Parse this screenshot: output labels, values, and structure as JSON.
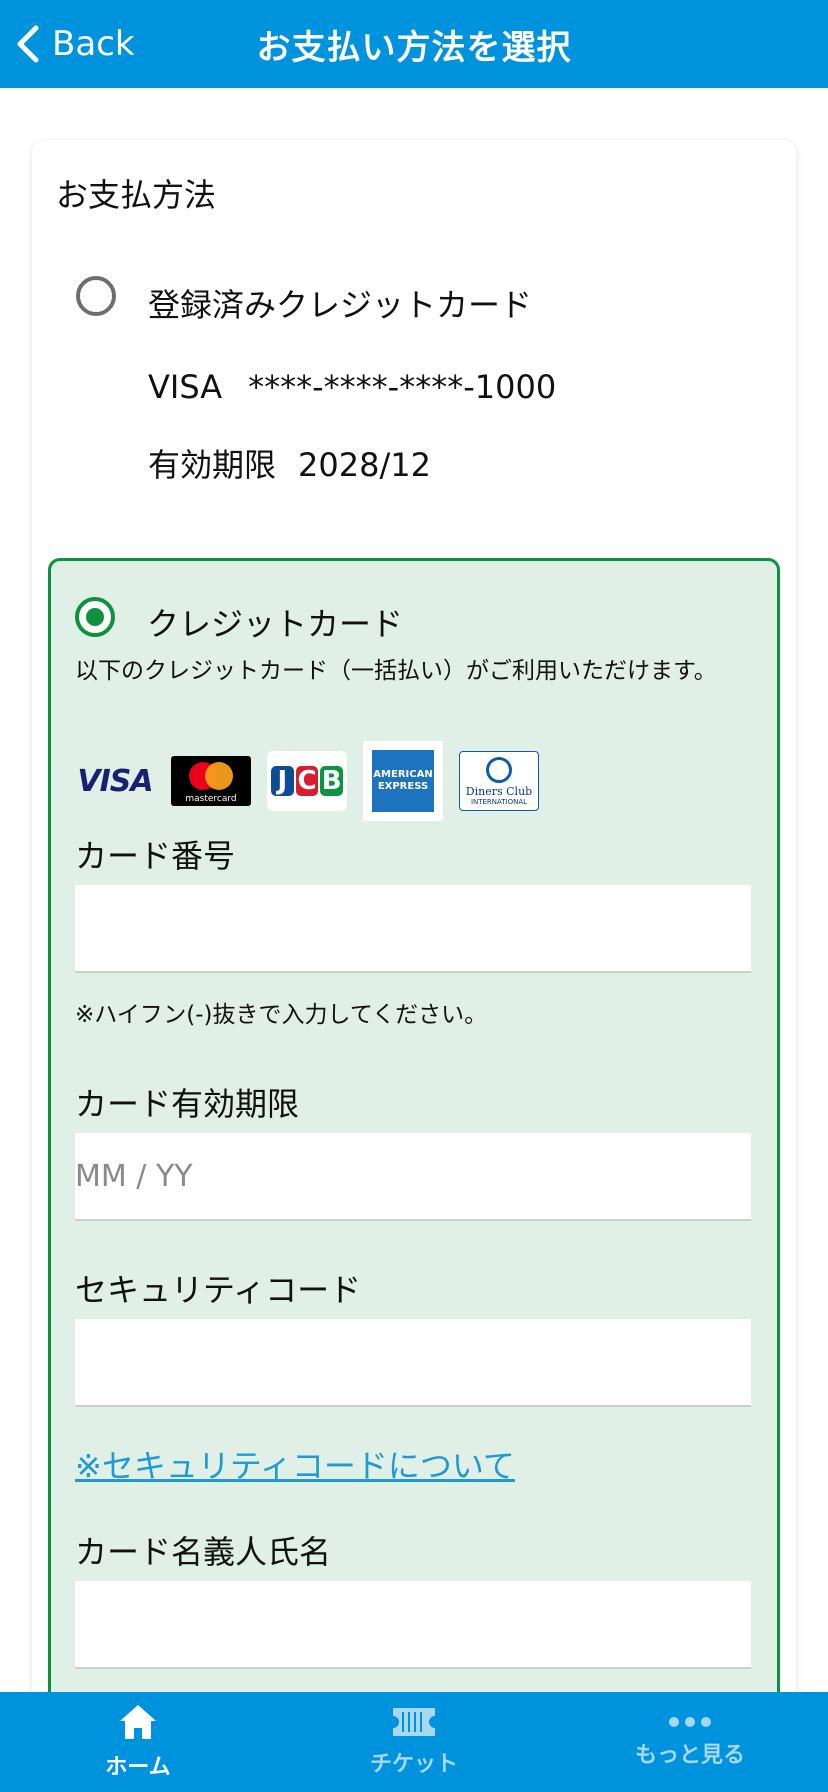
{
  "header": {
    "back_label": "Back",
    "title": "お支払い方法を選択"
  },
  "payment": {
    "section_title": "お支払方法",
    "saved": {
      "label": "登録済みクレジットカード",
      "brand": "VISA",
      "masked_number": "****-****-****-1000",
      "expiry_label": "有効期限",
      "expiry_value": "2028/12",
      "selected": false
    },
    "credit": {
      "label": "クレジットカード",
      "selected": true,
      "note": "以下のクレジットカード（一括払い）がご利用いただけます。",
      "brands": {
        "visa": "VISA",
        "mastercard": "mastercard",
        "jcb": [
          "J",
          "C",
          "B"
        ],
        "amex": [
          "AMERICAN",
          "EXPRESS"
        ],
        "diners": [
          "Diners Club",
          "INTERNATIONAL"
        ]
      },
      "card_number": {
        "label": "カード番号",
        "value": "",
        "placeholder": "",
        "hint": "※ハイフン(-)抜きで入力してください。"
      },
      "expiry": {
        "label": "カード有効期限",
        "value": "",
        "placeholder": "MM / YY"
      },
      "security": {
        "label": "セキュリティコード",
        "value": "",
        "placeholder": "",
        "link": "※セキュリティコードについて"
      },
      "holder": {
        "label": "カード名義人氏名",
        "value": "",
        "placeholder": ""
      }
    }
  },
  "nav": {
    "items": [
      {
        "label": "ホーム",
        "icon": "home-icon",
        "active": true
      },
      {
        "label": "チケット",
        "icon": "ticket-icon",
        "active": false
      },
      {
        "label": "もっと見る",
        "icon": "more-icon",
        "active": false
      }
    ]
  }
}
